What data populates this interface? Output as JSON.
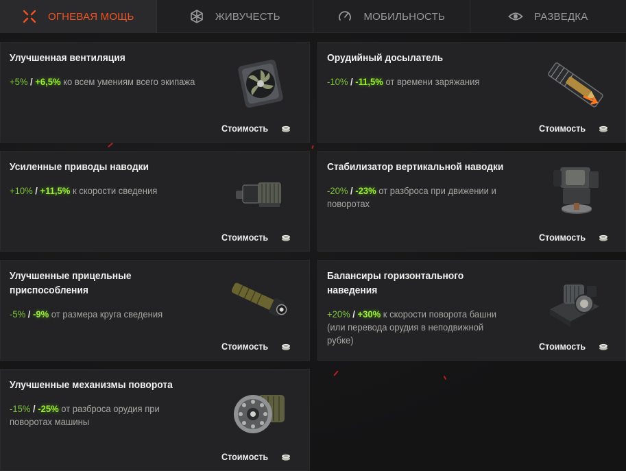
{
  "tabs": [
    {
      "label": "Огневая мощь",
      "icon": "crosshair-icon",
      "active": true
    },
    {
      "label": "Живучесть",
      "icon": "armor-icon",
      "active": false
    },
    {
      "label": "Мобильность",
      "icon": "speedometer-icon",
      "active": false
    },
    {
      "label": "Разведка",
      "icon": "eye-icon",
      "active": false
    }
  ],
  "colors": {
    "accent": "#f25322",
    "base_value": "#7ec83b",
    "bonus_value": "#9bf02f",
    "card_bg": "#232325"
  },
  "cost_label": "Стоимость",
  "cards": [
    {
      "title": "Улучшенная вентиляция",
      "base": "+5%",
      "slash": " / ",
      "bonus": "+6,5%",
      "text": " ко всем умениям всего экипажа",
      "icon": "ventilation-fan-icon"
    },
    {
      "title": "Орудийный досылатель",
      "base": "-10%",
      "slash": " / ",
      "bonus": "-11,5%",
      "text": " от времени заряжания",
      "icon": "rammer-shell-icon"
    },
    {
      "title": "Усиленные приводы наводки",
      "base": "+10%",
      "slash": " / ",
      "bonus": "+11,5%",
      "text": " к скорости сведения",
      "icon": "electric-motor-icon"
    },
    {
      "title": "Стабилизатор вертикальной наводки",
      "base": "-20%",
      "slash": " / ",
      "bonus": "-23%",
      "text": " от разброса при движении и поворотах",
      "icon": "stabilizer-gearbox-icon"
    },
    {
      "title": "Улучшенные прицельные приспособления",
      "base": "-5%",
      "slash": " / ",
      "bonus": "-9%",
      "text": " от размера круга сведения",
      "icon": "gun-sight-icon"
    },
    {
      "title": "Балансиры горизонтального наведения",
      "base": "+20%",
      "slash": " / ",
      "bonus": "+30%",
      "text": " к скорости поворота башни (или перевода орудия в неподвижной рубке)",
      "icon": "turret-balancer-icon"
    },
    {
      "title": "Улучшенные механизмы поворота",
      "base": "-15%",
      "slash": " / ",
      "bonus": "-25%",
      "text": " от разброса орудия при поворотах машины",
      "icon": "traverse-gear-icon"
    }
  ]
}
